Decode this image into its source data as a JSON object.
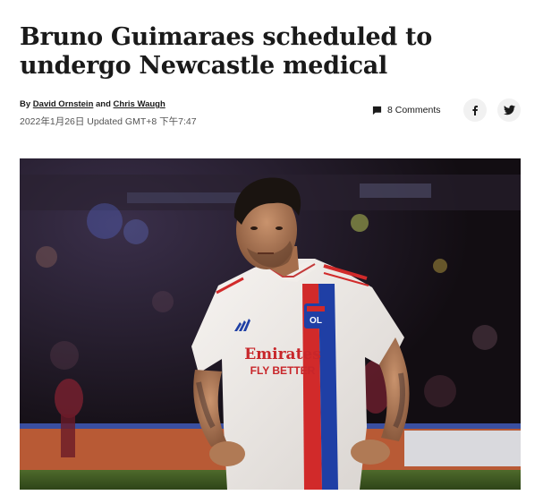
{
  "article": {
    "headline": "Bruno Guimaraes scheduled to undergo Newcastle medical",
    "byline": {
      "prefix": "By",
      "author1": "David Ornstein",
      "conjunction": "and",
      "author2": "Chris Waugh"
    },
    "date": "2022年1月26日 Updated GMT+8 下午7:47"
  },
  "actions": {
    "comments_label": "8 Comments",
    "comment_icon": "comment-icon",
    "facebook_icon": "facebook-icon",
    "twitter_icon": "twitter-icon"
  },
  "hero_image": {
    "shirt_sponsor": "Emirates",
    "shirt_tagline": "FLY BETTER",
    "club_badge": "OL"
  }
}
